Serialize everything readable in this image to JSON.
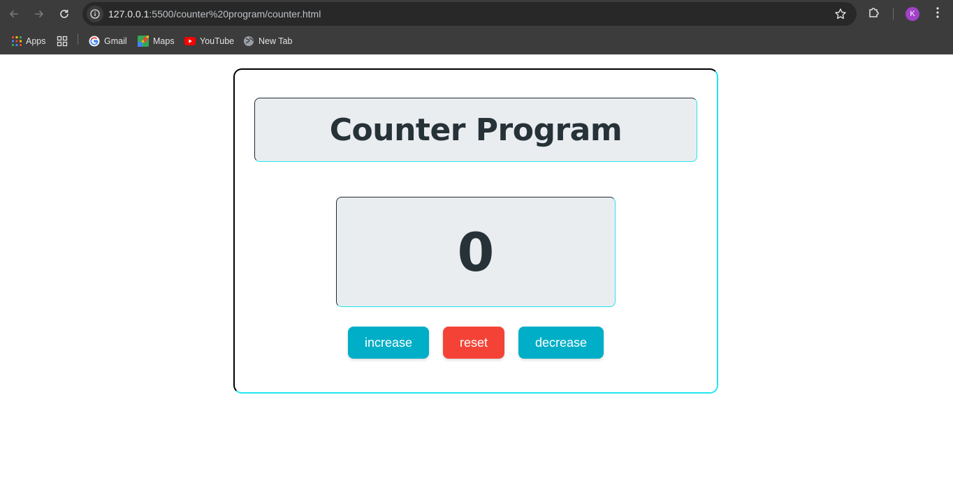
{
  "browser": {
    "url_host": "127.0.0.1",
    "url_path": ":5500/counter%20program/counter.html",
    "profile_initial": "K",
    "bookmarks": [
      {
        "label": "Apps",
        "icon": "apps-grid-icon"
      },
      {
        "label": "",
        "icon": "tab-groups-icon"
      },
      {
        "label": "Gmail",
        "icon": "google-icon"
      },
      {
        "label": "Maps",
        "icon": "maps-icon"
      },
      {
        "label": "YouTube",
        "icon": "youtube-icon"
      },
      {
        "label": "New Tab",
        "icon": "globe-icon"
      }
    ]
  },
  "page": {
    "title": "Counter Program",
    "count": "0",
    "buttons": {
      "increase": "increase",
      "reset": "reset",
      "decrease": "decrease"
    }
  },
  "colors": {
    "accent": "#00aec7",
    "reset": "#f44336",
    "panel": "#e9edf0",
    "text": "#263238",
    "border_cyan": "#22e6ee"
  }
}
